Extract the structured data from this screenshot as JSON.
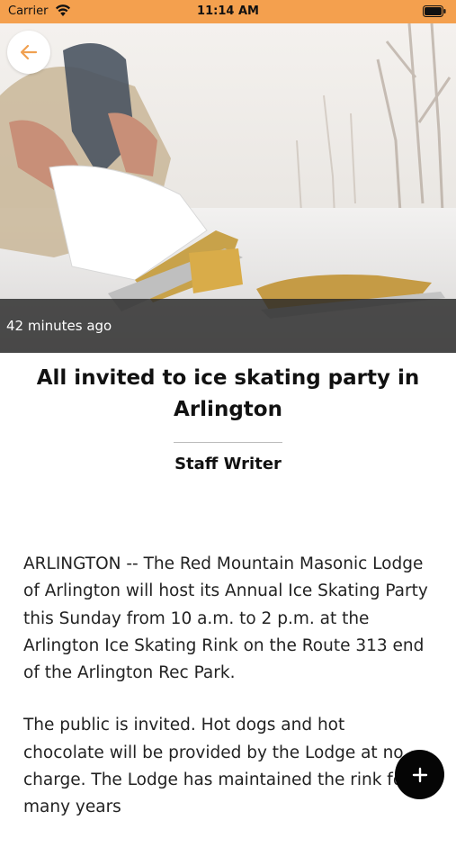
{
  "status_bar": {
    "carrier": "Carrier",
    "time": "11:14 AM",
    "wifi_icon": "wifi-icon",
    "battery_icon": "battery-icon"
  },
  "hero": {
    "image_description": "",
    "timestamp": "42 minutes ago",
    "back_icon": "arrow-left-icon"
  },
  "article": {
    "headline": "All invited to ice skating party in Arlington",
    "byline": "Staff Writer",
    "paragraphs": [
      "ARLINGTON -- The Red Mountain Masonic Lodge of Arlington will host its Annual Ice Skating Party this Sunday from 10 a.m. to 2 p.m. at the Arlington Ice Skating Rink on the Route 313 end of the Arlington Rec Park.",
      "The public is invited. Hot dogs and hot chocolate will be provided by the Lodge at no charge. The Lodge has maintained the rink for many years"
    ]
  },
  "fab": {
    "icon": "plus-icon"
  },
  "colors": {
    "status_bar": "#f4a04e",
    "accent": "#f0a050",
    "fab": "#050505",
    "timestamp_overlay": "#282828"
  }
}
